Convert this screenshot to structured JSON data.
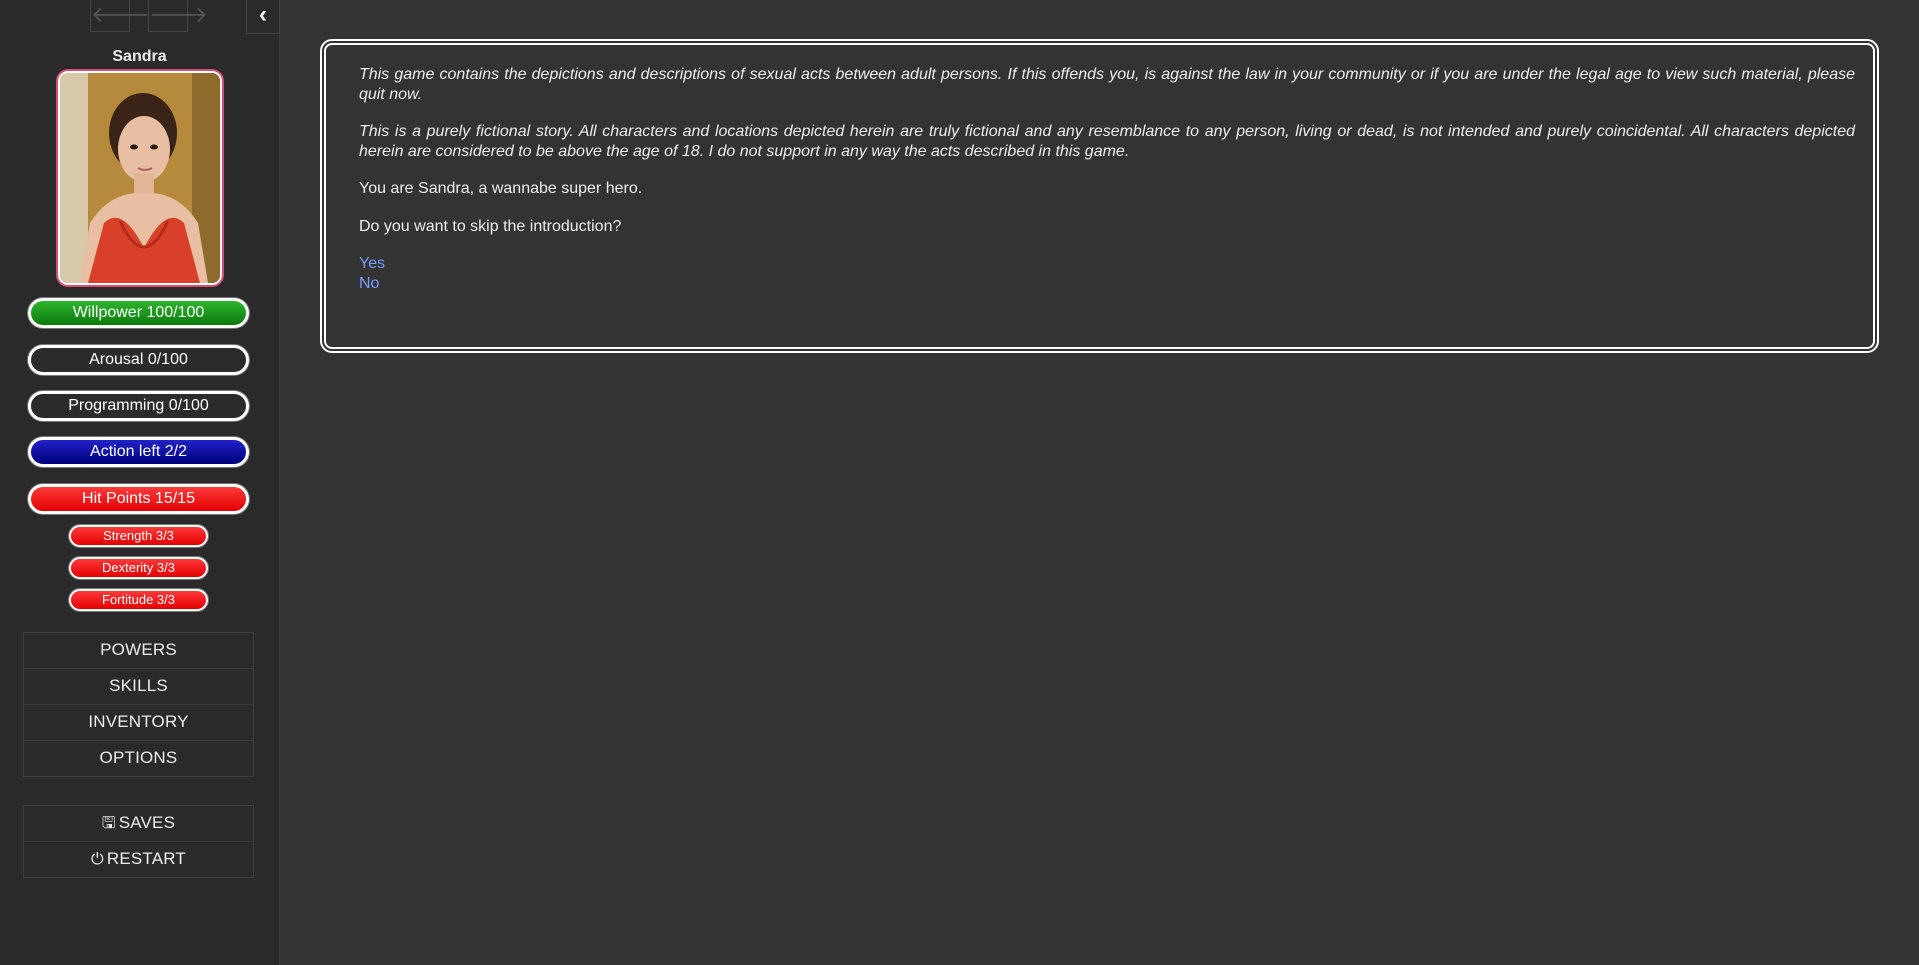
{
  "history": {
    "back_icon": "arrow-left-icon",
    "forward_icon": "arrow-right-icon"
  },
  "ui": {
    "toggle_icon": "chevron-left-icon"
  },
  "character": {
    "name": "Sandra"
  },
  "stats": {
    "willpower": "Willpower 100/100",
    "arousal": "Arousal 0/100",
    "programming": "Programming 0/100",
    "action": "Action left 2/2",
    "hit_points": "Hit Points 15/15",
    "strength": "Strength 3/3",
    "dexterity": "Dexterity 3/3",
    "fortitude": "Fortitude 3/3"
  },
  "menu": {
    "items": [
      "POWERS",
      "SKILLS",
      "INVENTORY",
      "OPTIONS"
    ],
    "saves": "SAVES",
    "restart": "RESTART"
  },
  "passage": {
    "disclaimer1": "This game contains the depictions and descriptions of sexual acts between adult persons. If this offends you, is against the law in your community or if you are under the legal age to view such material, please quit now.",
    "disclaimer2": "This is a purely fictional story. All characters and locations depicted herein are truly fictional and any resemblance to any person, living or dead, is not intended and purely coincidental. All characters depicted herein are considered to be above the age of 18. I do not support in any way the acts described in this game.",
    "intro": "You are Sandra, a wannabe super hero.",
    "question": "Do you want to skip the introduction?",
    "choices": [
      "Yes",
      "No"
    ]
  },
  "colors": {
    "background": "#333333",
    "sidebar": "#2a2a2a",
    "link": "#7b9cff",
    "willpower": "#0b8a0b",
    "action": "#00008f",
    "hit_points": "#ff0000",
    "portrait_border": "#d94f74"
  }
}
